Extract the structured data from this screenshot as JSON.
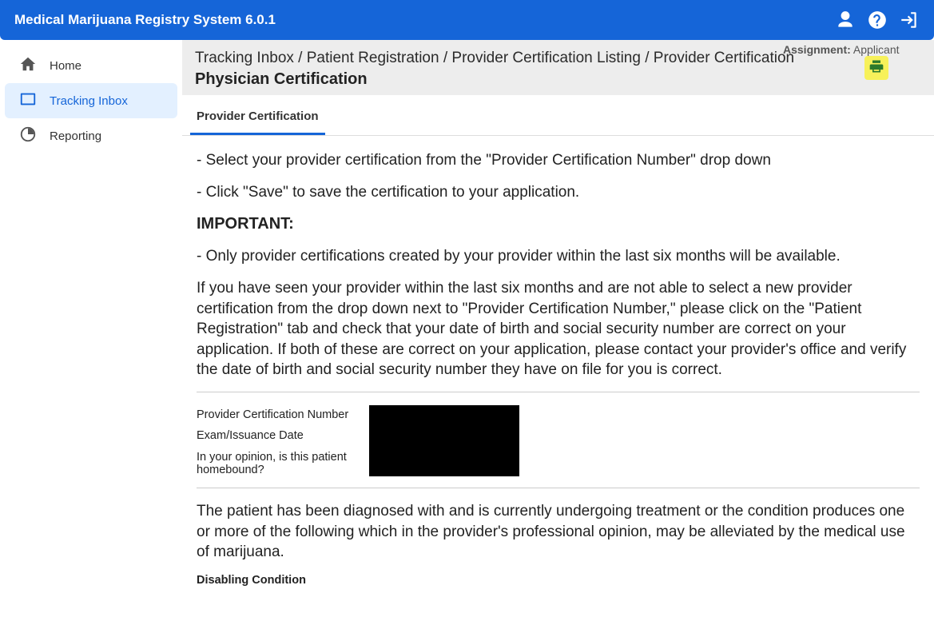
{
  "topbar": {
    "title": "Medical Marijuana Registry System 6.0.1"
  },
  "sidebar": {
    "items": [
      {
        "label": "Home"
      },
      {
        "label": "Tracking Inbox"
      },
      {
        "label": "Reporting"
      }
    ]
  },
  "header": {
    "breadcrumbs": "Tracking Inbox / Patient Registration / Provider Certification Listing / Provider Certification",
    "page_title": "Physician Certification",
    "assignment_label": "Assignment:",
    "assignment_value": "Applicant"
  },
  "tabs": {
    "items": [
      {
        "label": "Provider Certification"
      }
    ]
  },
  "content": {
    "line1": "- Select your provider certification from the \"Provider Certification Number\" drop down",
    "line2": "- Click \"Save\" to save the certification to your application.",
    "important": "IMPORTANT:",
    "line3": "- Only provider certifications created by your provider within the last six months will be available.",
    "line4": "If you have seen your provider within the last six months and are not able to select a new provider certification from the drop down next to \"Provider Certification Number,\" please click on the \"Patient Registration\" tab and check that your date of birth and social security number are correct on your application. If both of these are correct on your application, please contact your provider's office and verify the date of birth and social security number they have on file for you is correct.",
    "fields": {
      "pcn_label": "Provider Certification Number",
      "exam_label": "Exam/Issuance Date",
      "homebound_label": "In your opinion, is this patient homebound?"
    },
    "diagnosis": "The patient has been diagnosed with and is currently undergoing treatment or the condition produces one or more of the following which in the provider's professional opinion, may be alleviated by the medical use of marijuana.",
    "disabling_label": "Disabling Condition"
  }
}
